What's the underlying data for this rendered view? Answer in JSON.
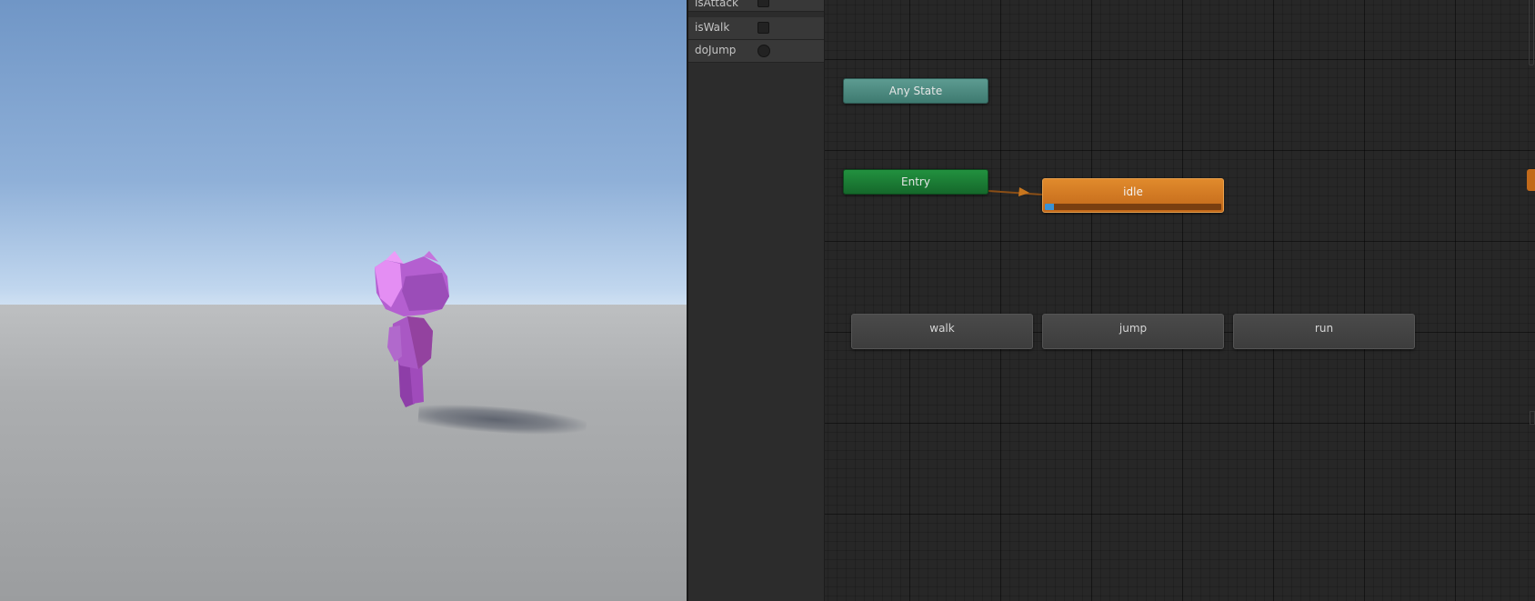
{
  "parameters": [
    {
      "name": "isAttack",
      "type": "bool"
    },
    {
      "name": "isWalk",
      "type": "bool"
    },
    {
      "name": "doJump",
      "type": "trigger"
    }
  ],
  "graph": {
    "nodes": {
      "any_state": "Any State",
      "entry": "Entry",
      "idle": "idle",
      "walk": "walk",
      "jump": "jump",
      "run": "run"
    },
    "idle_progress": 0.05
  },
  "colors": {
    "any_state": "#4f8d83",
    "entry": "#1c7d36",
    "active_state": "#d57a22",
    "progress": "#3a92d4",
    "character": "#a35dc0"
  }
}
